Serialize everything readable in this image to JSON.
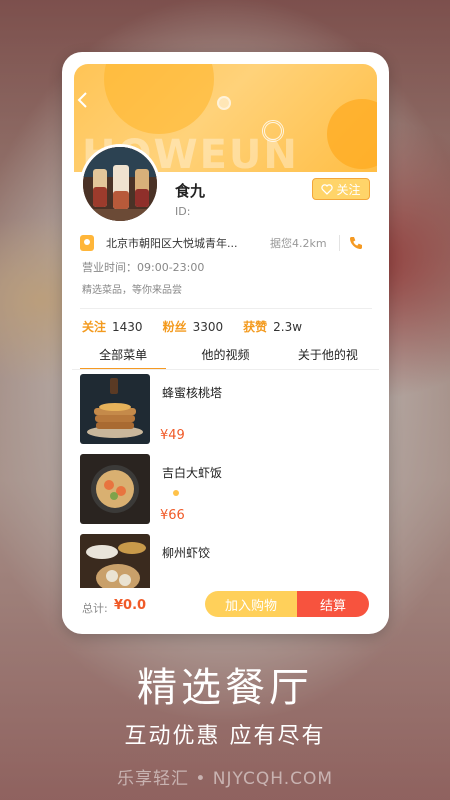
{
  "store": {
    "name": "食九",
    "id_label": "ID:",
    "follow_label": "关注",
    "address": "北京市朝阳区大悦城青年...",
    "distance": "据您4.2km",
    "hours": "营业时间：09:00-23:00",
    "slogan": "精选菜品，等你来品尝"
  },
  "stats": [
    {
      "label": "关注",
      "value": "1430"
    },
    {
      "label": "粉丝",
      "value": "3300"
    },
    {
      "label": "获赞",
      "value": "2.3w"
    }
  ],
  "tabs": [
    {
      "label": "全部菜单",
      "active": true
    },
    {
      "label": "他的视频",
      "active": false
    },
    {
      "label": "关于他的视",
      "active": false
    }
  ],
  "items": [
    {
      "name": "蜂蜜核桃塔",
      "price": "¥49"
    },
    {
      "name": "吉白大虾饭",
      "price": "¥66"
    },
    {
      "name": "柳州虾饺",
      "price": ""
    }
  ],
  "footer": {
    "total_label": "总计:",
    "total_value": "¥0.0",
    "cart_label": "加入购物",
    "pay_label": "结算"
  },
  "promo": {
    "headline": "精选餐厅",
    "subheadline": "互动优惠  应有尽有",
    "watermark": "乐享轻汇 • NJYCQH.COM"
  },
  "hero_watermark": "HOWEUN",
  "colors": {
    "accent": "#f59a23",
    "price": "#f05a28",
    "pay": "#f7533e",
    "cart": "#ffd05a"
  }
}
